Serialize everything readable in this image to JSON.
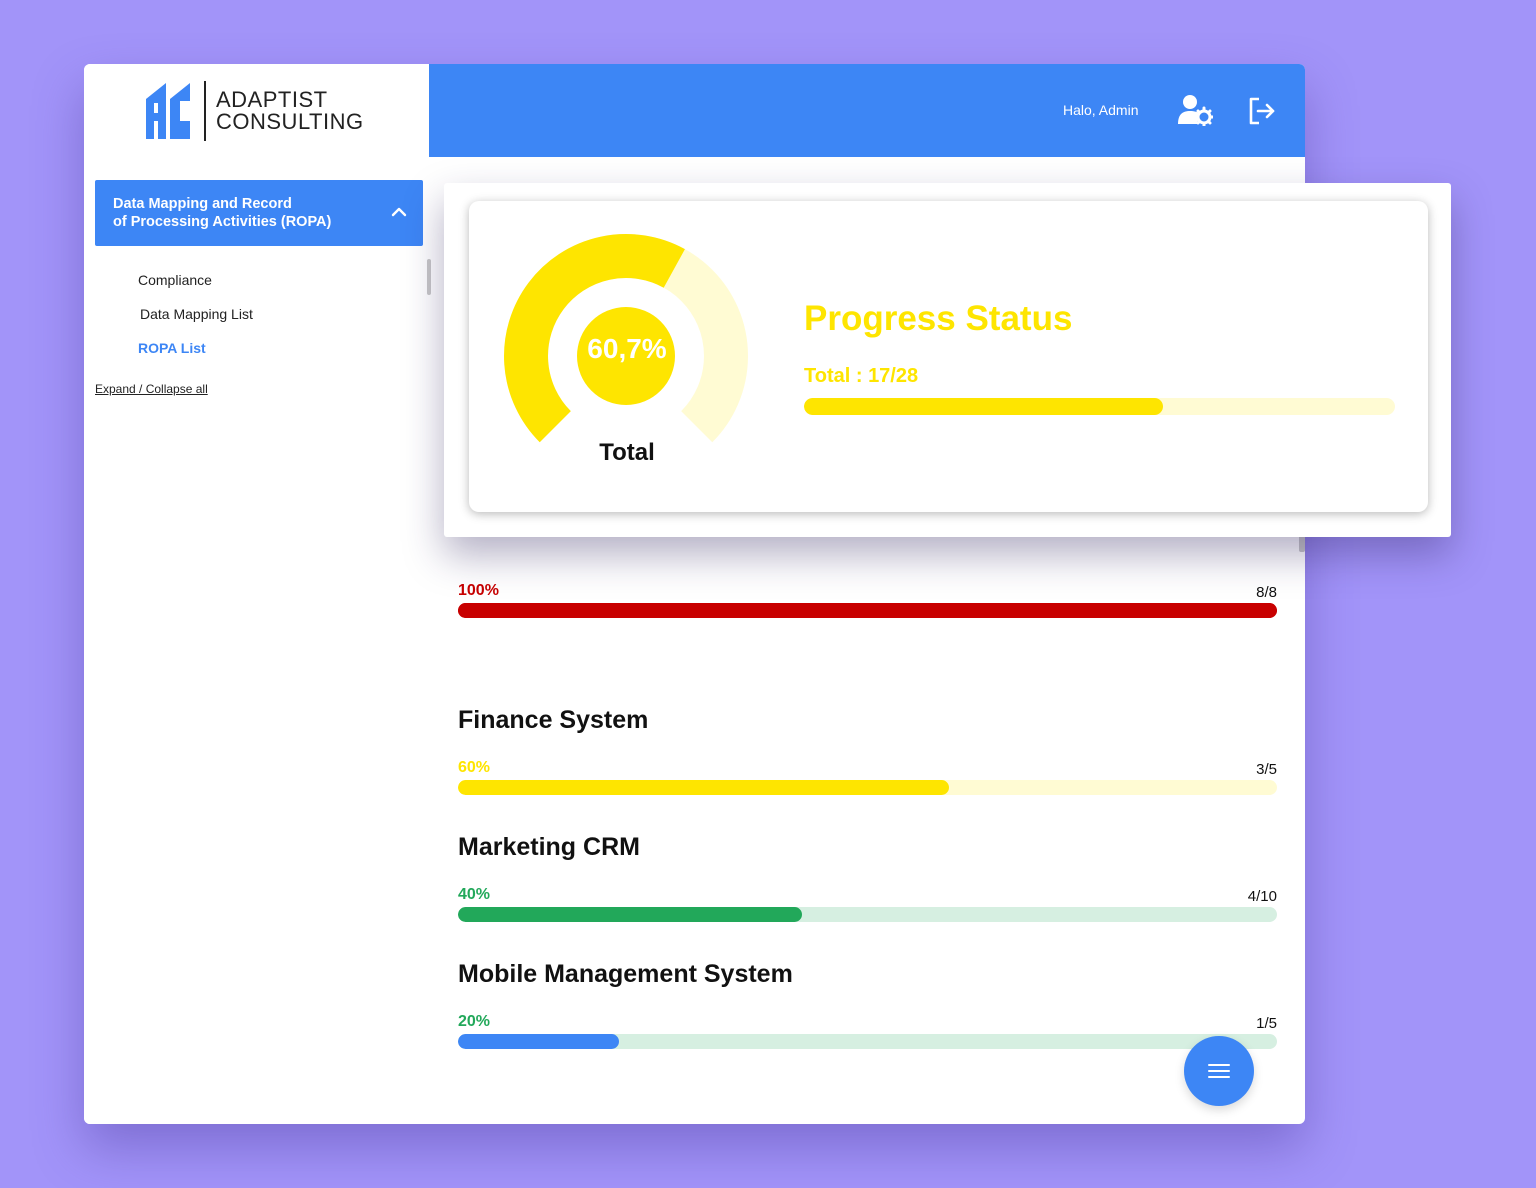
{
  "brand": {
    "name_line1": "ADAPTIST",
    "name_line2": "CONSULTING",
    "logo_letters": "AC",
    "color": "#3d86f5"
  },
  "header": {
    "greeting": "Halo, Admin",
    "user_settings_icon": "user-gear-icon",
    "logout_icon": "logout-icon"
  },
  "sidebar": {
    "accordion": {
      "title_line1": "Data Mapping and Record",
      "title_line2": "of Processing Activities (ROPA)",
      "icon": "chevron-up-icon",
      "expanded": true
    },
    "items": [
      {
        "label": "Compliance",
        "active": false
      },
      {
        "label": "Data Mapping List",
        "active": false
      },
      {
        "label": "ROPA List",
        "active": true
      }
    ],
    "expand_collapse": "Expand / Collapse all"
  },
  "progress_status": {
    "title": "Progress Status",
    "total_label": "Total : 17/28",
    "total_done": 17,
    "total_count": 28,
    "gauge_percent_text": "60,7%",
    "gauge_fraction": 0.607,
    "gauge_label": "Total",
    "color": "#fee500",
    "track_color": "#fffbd3"
  },
  "systems": [
    {
      "title": "",
      "percent_text": "100%",
      "count_text": "8/8",
      "fraction": 1.0,
      "label_color": "#c80000",
      "fill_color": "#c80000",
      "track_color": "#c80000"
    },
    {
      "title": "Finance System",
      "percent_text": "60%",
      "count_text": "3/5",
      "fraction": 0.6,
      "label_color": "#fee500",
      "fill_color": "#fee500",
      "track_color": "#fffbd3"
    },
    {
      "title": "Marketing CRM",
      "percent_text": "40%",
      "count_text": "4/10",
      "fraction": 0.42,
      "label_color": "#22a85a",
      "fill_color": "#22a85a",
      "track_color": "#d6efe1"
    },
    {
      "title": "Mobile Management System",
      "percent_text": "20%",
      "count_text": "1/5",
      "fraction": 0.196,
      "label_color": "#22a85a",
      "fill_color": "#3d86f5",
      "track_color": "#d6efe1"
    }
  ],
  "fab": {
    "icon": "menu-icon"
  }
}
